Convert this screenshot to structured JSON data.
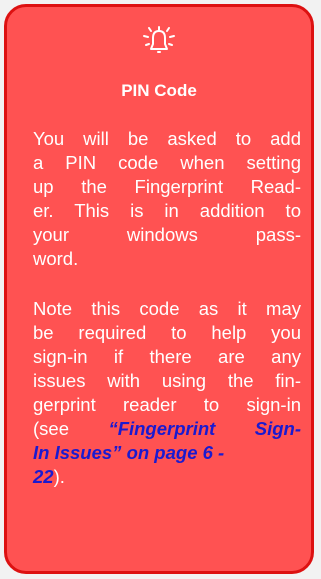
{
  "icon": "bell-icon",
  "colors": {
    "card_fill": "#ff5252",
    "card_border": "#dd1111",
    "text": "#ffffff",
    "link": "#1a1ad0"
  },
  "title": "PIN Code",
  "para1": [
    "You will be asked to add",
    "a PIN code when setting",
    "up the Fingerprint Read-",
    "er. This is in addition to",
    "your windows pass-",
    "word."
  ],
  "para2": {
    "lines": [
      "Note this code as it may",
      "be required to help you",
      "sign-in if there are any",
      "issues with using the fin-",
      "gerprint reader to sign-in"
    ],
    "ref_prefix": "(see ",
    "ref_line1": "“Fingerprint Sign-",
    "ref_line2a": "In Issues” on page 6 -",
    "ref_line3": "22",
    "ref_suffix": ")."
  }
}
